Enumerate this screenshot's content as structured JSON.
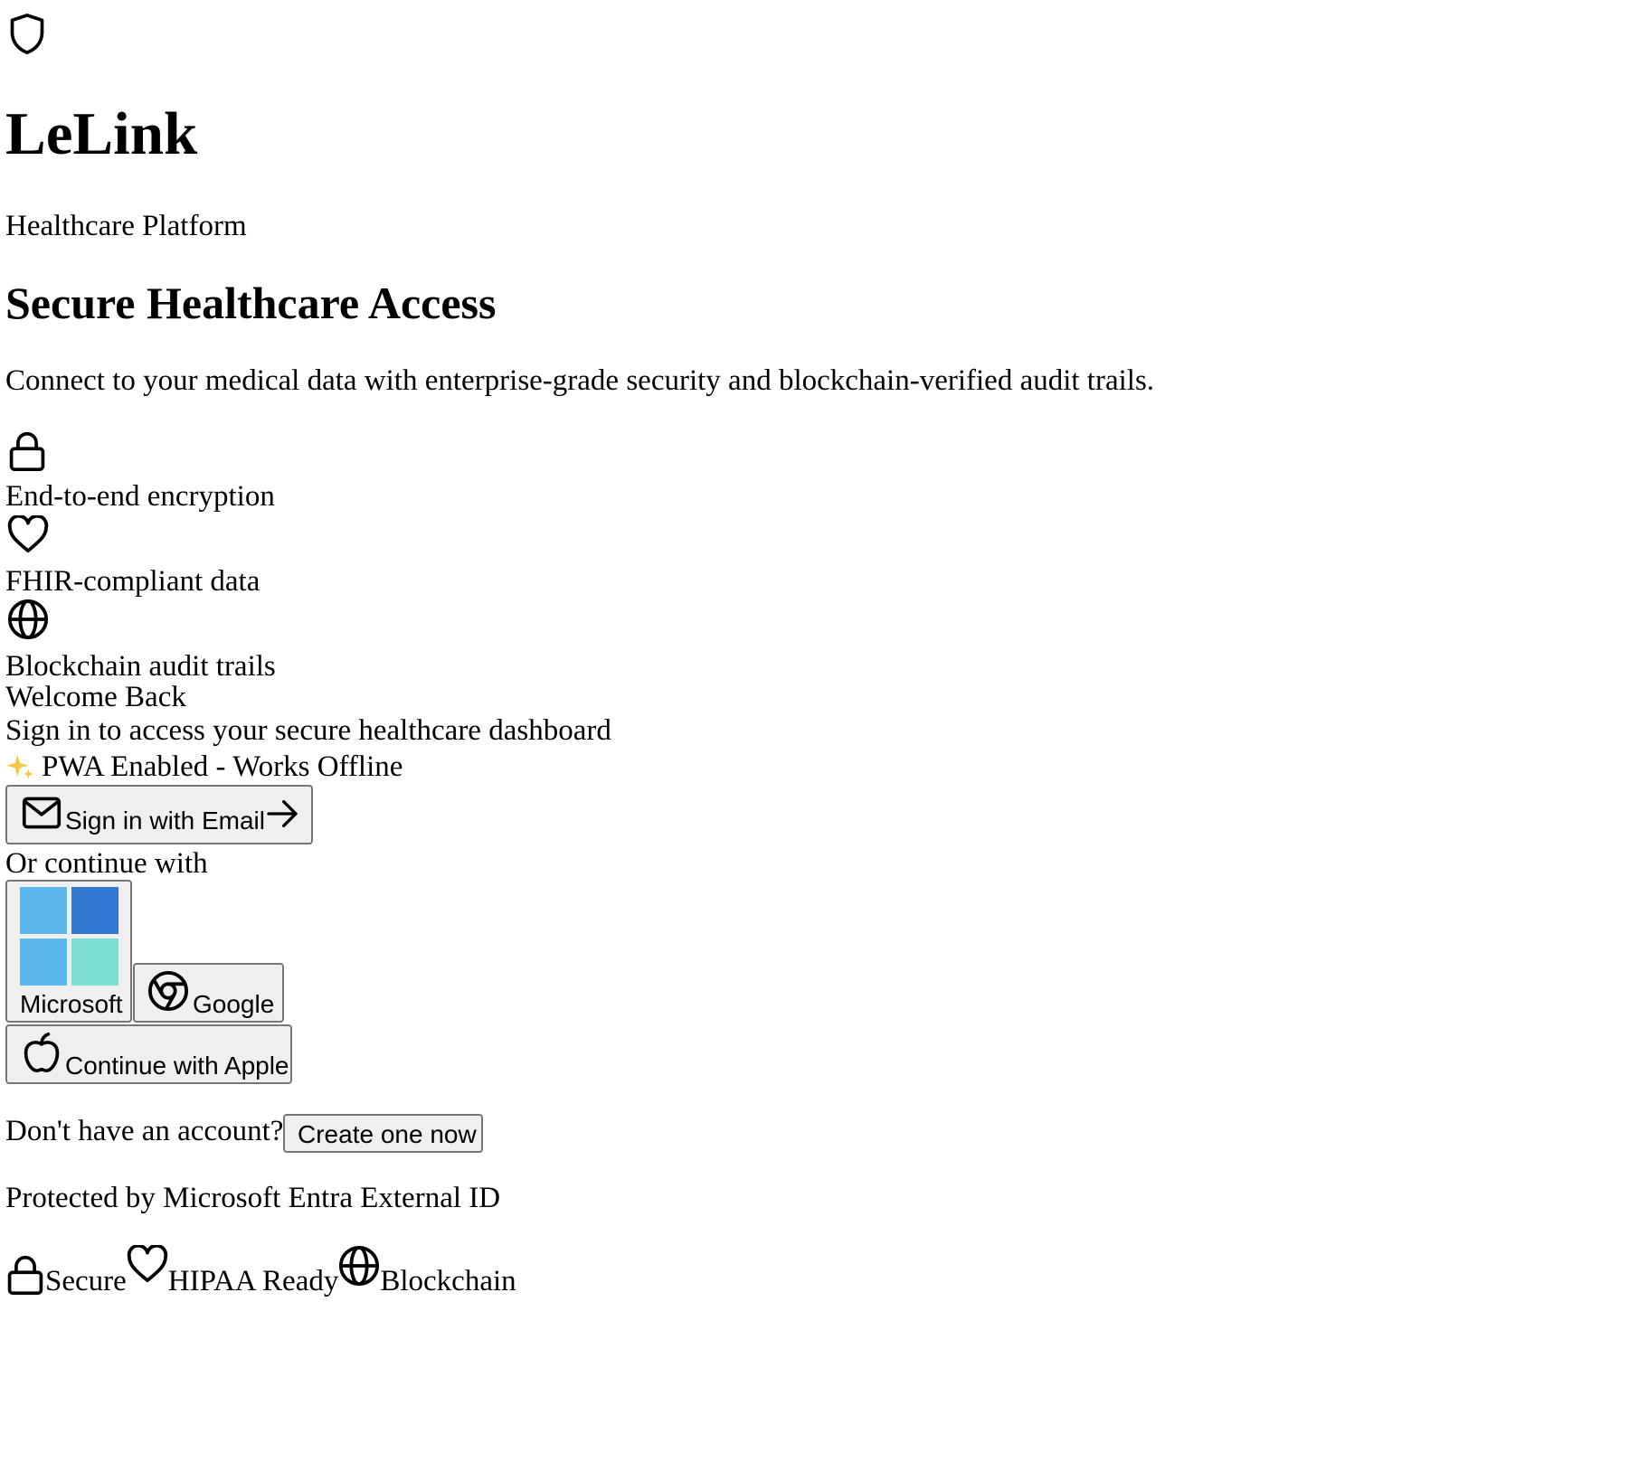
{
  "brand": {
    "icon": "shield-icon",
    "title": "LeLink",
    "subtitle": "Healthcare Platform"
  },
  "hero": {
    "heading": "Secure Healthcare Access",
    "description": "Connect to your medical data with enterprise-grade security and blockchain-verified audit trails."
  },
  "features": [
    {
      "icon": "lock-icon",
      "label": "End-to-end encryption"
    },
    {
      "icon": "heart-icon",
      "label": "FHIR-compliant data"
    },
    {
      "icon": "globe-icon",
      "label": "Blockchain audit trails"
    }
  ],
  "signin": {
    "title": "Welcome Back",
    "subtitle": "Sign in to access your secure healthcare dashboard",
    "pwa_badge": "PWA Enabled - Works Offline",
    "email_button": "Sign in with Email",
    "divider": "Or continue with",
    "providers": {
      "microsoft": "Microsoft",
      "google": "Google",
      "apple": "Continue with Apple"
    },
    "no_account": "Don't have an account?",
    "create_button": "Create one now",
    "protected_by": "Protected by Microsoft Entra External ID"
  },
  "trust_badges": [
    {
      "icon": "lock-icon",
      "label": "Secure"
    },
    {
      "icon": "heart-icon",
      "label": "HIPAA Ready"
    },
    {
      "icon": "globe-icon",
      "label": "Blockchain"
    }
  ],
  "colors": {
    "ms_top_left": "#5bb8ec",
    "ms_top_right": "#3279d4",
    "ms_bottom_left": "#5bb8ec",
    "ms_bottom_right": "#7adfd0",
    "sparkle": "#f5c842"
  }
}
